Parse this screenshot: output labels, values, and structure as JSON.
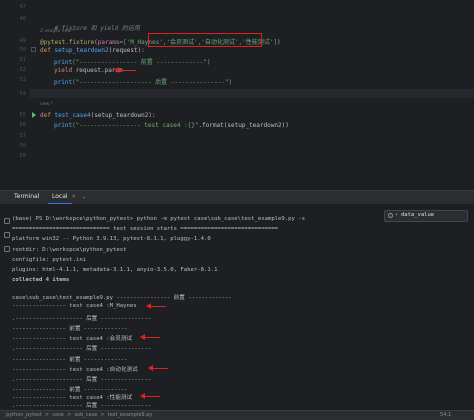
{
  "editor": {
    "line_numbers": [
      "47",
      "48",
      "",
      "49",
      "50",
      "51",
      "52",
      "53",
      "54",
      "",
      "55",
      "56",
      "57",
      "58",
      "59"
    ],
    "usage_hint_1": "2 usages  new *",
    "usage_hint_2": "new *",
    "comment": "# fixture 和 yield 的运用",
    "decorator_prefix": "@pytest.fixture(",
    "decorator_params_kw": "params=",
    "decorator_params_value": "['M_Haynes','会员测试','自动化测试','性能测试']",
    "decorator_suffix": ")",
    "def1_kw": "def ",
    "def1_name": "setup_teardown2",
    "def1_args": "(request):",
    "print1_fn": "print",
    "print1_str": "(\"---------------- 前置 -------------\")",
    "yield_kw": "yield ",
    "yield_expr": "request.param",
    "print2_fn": "print",
    "print2_str": "(\"-------------------- 后置 ---------------\")",
    "def2_kw": "def ",
    "def2_name": "test_case4",
    "def2_args": "(setup_teardown2):",
    "print3_fn": "print",
    "print3_str": "(\"----------------- test case4 :{}\"",
    "print3_rest": ".format(setup_teardown2))"
  },
  "terminal": {
    "tab_terminal": "Terminal",
    "tab_local": "Local",
    "tab_close": "×",
    "tab_dropdown": "⌄",
    "search_value": "data_value",
    "lines": [
      "(base) PS D:\\workspce\\python_pytest> python -m pytest case\\sub_case\\test_example9.py -s",
      "============================= test session starts =============================",
      "platform win32 -- Python 3.9.13, pytest-8.1.1, pluggy-1.4.0",
      "rootdir: D:\\workspce\\python_pytest",
      "configfile: pytest.ini",
      "plugins: html-4.1.1, metadata-3.1.1, anyio-3.5.0, Faker-8.1.1",
      "collected 4 items",
      "",
      "case\\sub_case\\test_example9.py ---------------- 前置 -------------",
      "---------------- test case4 :M_Haynes",
      ".-------------------- 后置 ---------------",
      "---------------- 前置 -------------",
      "---------------- test case4 :会员测试",
      ".-------------------- 后置 ---------------",
      "---------------- 前置 -------------",
      "---------------- test case4 :自动化测试",
      ".-------------------- 后置 ---------------",
      "---------------- 前置 -------------",
      "---------------- test case4 :性能测试",
      ".-------------------- 后置 ---------------"
    ]
  },
  "statusbar": {
    "left": "python_pytest  >  case  >  sub_case  >  test_example9.py",
    "right": "54:1"
  },
  "colors": {
    "annotation_red": "#e02020",
    "accent_blue": "#3574f0"
  }
}
